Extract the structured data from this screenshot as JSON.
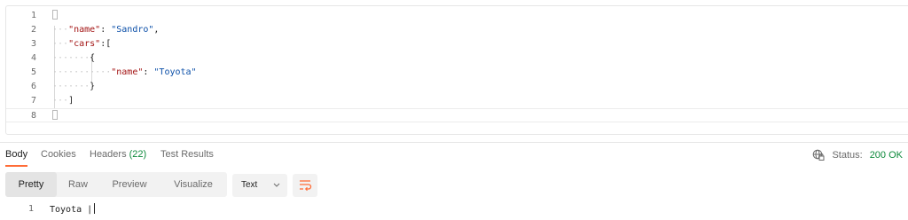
{
  "editor": {
    "lines": [
      {
        "num": "1",
        "text": "{"
      },
      {
        "num": "2",
        "key": "\"name\"",
        "sep": ": ",
        "value": "\"Sandro\"",
        "trail": ","
      },
      {
        "num": "3",
        "key": "\"cars\"",
        "sep": ":",
        "trail": "["
      },
      {
        "num": "4",
        "text": "{"
      },
      {
        "num": "5",
        "key": "\"name\"",
        "sep": ": ",
        "value": "\"Toyota\""
      },
      {
        "num": "6",
        "text": "}"
      },
      {
        "num": "7",
        "text": "]"
      },
      {
        "num": "8",
        "text": "}"
      }
    ]
  },
  "response": {
    "tabs": {
      "body": "Body",
      "cookies": "Cookies",
      "headers": "Headers",
      "headers_count": "(22)",
      "test_results": "Test Results"
    },
    "status_label": "Status:",
    "status_value": "200 OK",
    "view_modes": [
      "Pretty",
      "Raw",
      "Preview",
      "Visualize"
    ],
    "active_view": "Pretty",
    "format": "Text",
    "output": {
      "num": "1",
      "text": "Toyota |"
    }
  },
  "colors": {
    "accent": "#ff6c37",
    "success": "#0e8a3c"
  }
}
